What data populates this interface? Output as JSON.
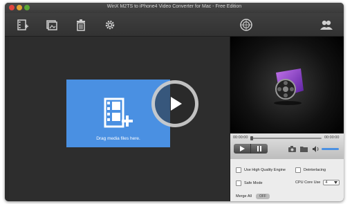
{
  "window": {
    "title": "WinX M2TS to iPhone4 Video Converter for Mac - Free Edition"
  },
  "toolbar": {
    "items": [
      {
        "name": "add-video-icon"
      },
      {
        "name": "add-photo-icon"
      },
      {
        "name": "trash-icon"
      },
      {
        "name": "settings-gear-icon"
      },
      {
        "name": "update-globe-icon"
      },
      {
        "name": "users-icon"
      }
    ]
  },
  "dropzone": {
    "label": "Drag media files here."
  },
  "player": {
    "time_elapsed": "00:00:00",
    "time_total": "00:00:00"
  },
  "settings": {
    "high_quality_label": "Use High Quality Engine",
    "deinterlacing_label": "Deinterlacing",
    "safe_mode_label": "Safe Mode",
    "cpu_core_label": "CPU Core Use",
    "cpu_core_value": "4",
    "merge_all_label": "Merge All",
    "merge_all_state": "OFF"
  },
  "colors": {
    "accent": "#4a90e2",
    "dark_bg": "#2d2d2d"
  }
}
